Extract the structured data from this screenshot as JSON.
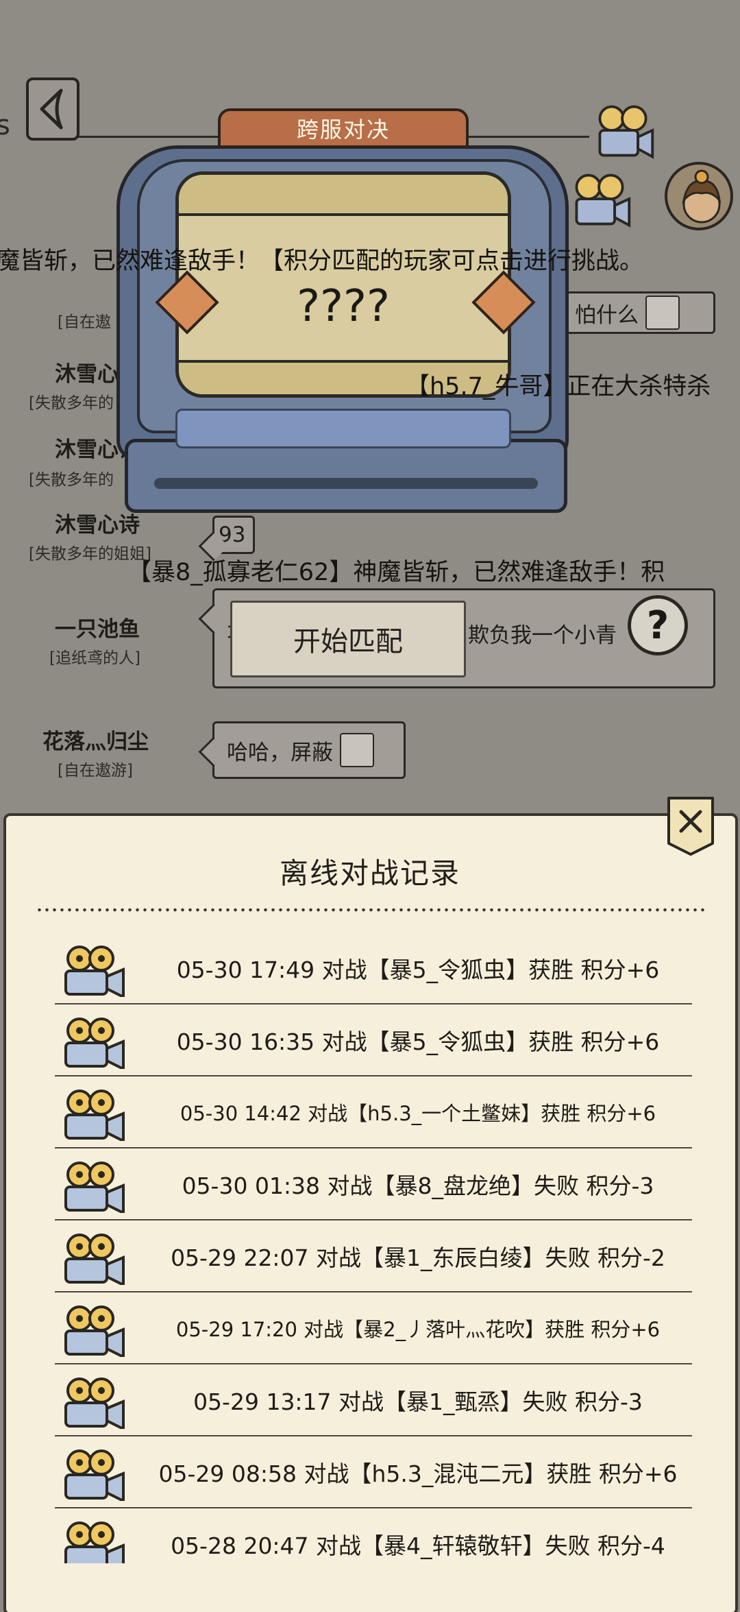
{
  "header": {
    "title": "跨服对决",
    "back_glyph": "<"
  },
  "left_edge_glyph": "s",
  "marquee": {
    "line1": "魔皆斩，已然难逢敌手！【积分匹配的玩家可点击进行挑战。",
    "line2": "【h5.7_牛哥】正在大杀特杀",
    "line3": "【暴8_孤寡老仁62】神魔皆斩，已然难逢敌手！积"
  },
  "tv": {
    "placeholder": "????",
    "screen_fragment": "【 ",
    "match_button": "开始匹配",
    "help_glyph": "?"
  },
  "chat": [
    {
      "name": "",
      "title": "[自在遨",
      "message": "怕什么"
    },
    {
      "name": "沐雪心",
      "title": "[失散多年的",
      "message": ""
    },
    {
      "name": "沐雪心诗",
      "title": "[失散多年的",
      "message": ""
    },
    {
      "name": "沐雪心诗",
      "title": "[失散多年的姐姐]",
      "message": "93"
    },
    {
      "name": "一只池鱼",
      "title": "[追纸鸢的人]",
      "message": "不",
      "message2": "欺负我一个小青"
    },
    {
      "name": "花落灬归尘",
      "title": "[自在遨游]",
      "message": "哈哈，屏蔽"
    }
  ],
  "log": {
    "title": "离线对战记录",
    "close_glyph": "✕",
    "records": [
      {
        "text": "05-30 17:49 对战【暴5_令狐虫】获胜 积分+6",
        "size": "normal"
      },
      {
        "text": "05-30 16:35 对战【暴5_令狐虫】获胜 积分+6",
        "size": "normal"
      },
      {
        "text": "05-30 14:42 对战【h5.3_一个土鳖妹】获胜 积分+6",
        "size": "small"
      },
      {
        "text": "05-30 01:38 对战【暴8_盘龙绝】失败 积分-3",
        "size": "normal"
      },
      {
        "text": "05-29 22:07 对战【暴1_东辰白绫】失败 积分-2",
        "size": "normal"
      },
      {
        "text": "05-29 17:20 对战【暴2_丿落叶灬花吹】获胜 积分+6",
        "size": "small"
      },
      {
        "text": "05-29 13:17 对战【暴1_甄烝】失败 积分-3",
        "size": "normal"
      },
      {
        "text": "05-29 08:58 对战【h5.3_混沌二元】获胜 积分+6",
        "size": "normal"
      },
      {
        "text": "05-28 20:47 对战【暴4_轩辕敬轩】失败 积分-4",
        "size": "normal"
      }
    ]
  },
  "colors": {
    "overlay": "#8e8a83",
    "panel_bg": "#f6efdc",
    "tv_blue": "#5d6f8c",
    "header_orange": "#b86e46",
    "screen_yellow": "#d9cca1"
  },
  "icons": {
    "record": "film-camera-icon",
    "close": "close-icon",
    "help": "question-mark-icon",
    "back": "back-arrow-icon"
  }
}
